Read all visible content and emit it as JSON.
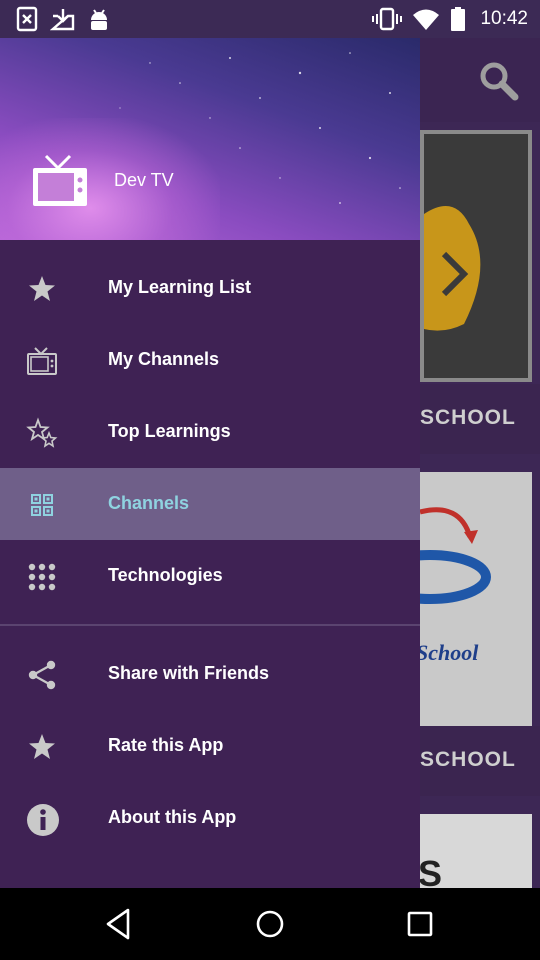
{
  "status_bar": {
    "time": "10:42",
    "left_icons": [
      "x-file-icon",
      "download-inbox-icon",
      "android-icon"
    ],
    "right_icons": [
      "vibrate-icon",
      "wifi-icon",
      "battery-icon"
    ]
  },
  "drawer": {
    "header": {
      "app_name": "Dev TV",
      "logo_icon": "tv-icon"
    },
    "menu_items": [
      {
        "label": "My Learning List",
        "icon": "star-icon",
        "active": false
      },
      {
        "label": "My Channels",
        "icon": "tv-icon",
        "active": false
      },
      {
        "label": "Top Learnings",
        "icon": "stars-icon",
        "active": false
      },
      {
        "label": "Channels",
        "icon": "grid-icon",
        "active": true
      },
      {
        "label": "Technologies",
        "icon": "apps-grid-icon",
        "active": false
      }
    ],
    "secondary_items": [
      {
        "label": "Share with Friends",
        "icon": "share-icon"
      },
      {
        "label": "Rate this App",
        "icon": "star-icon"
      },
      {
        "label": "About this App",
        "icon": "info-icon"
      }
    ]
  },
  "background": {
    "labels": [
      "SCHOOL",
      "SCHOOL"
    ],
    "card_text": "School",
    "partial_text": "S"
  },
  "colors": {
    "drawer_bg": "#3f2254",
    "active_item_bg": "#6f5f89",
    "active_item_text": "#8fd3e0"
  },
  "nav_bar": {
    "buttons": [
      "back-icon",
      "home-icon",
      "recents-icon"
    ]
  }
}
